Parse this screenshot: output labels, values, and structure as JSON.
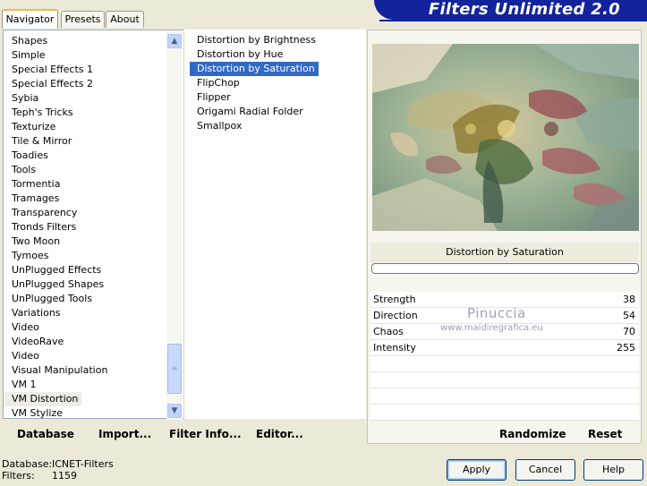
{
  "brand": {
    "title": "Filters Unlimited 2.0"
  },
  "tabs": [
    {
      "label": "Navigator",
      "active": true
    },
    {
      "label": "Presets",
      "active": false
    },
    {
      "label": "About",
      "active": false
    }
  ],
  "categories": {
    "items": [
      "Shapes",
      "Simple",
      "Special Effects 1",
      "Special Effects 2",
      "Sybia",
      "Teph's Tricks",
      "Texturize",
      "Tile & Mirror",
      "Toadies",
      "Tools",
      "Tormentia",
      "Tramages",
      "Transparency",
      "Tronds Filters",
      "Two Moon",
      "Tymoes",
      "UnPlugged Effects",
      "UnPlugged Shapes",
      "UnPlugged Tools",
      "Variations",
      "Video",
      "VideoRave",
      "Video",
      "Visual Manipulation",
      "VM 1",
      "VM Distortion",
      "VM Stylize"
    ],
    "selected": "VM Distortion"
  },
  "filters": {
    "items": [
      "Distortion by Brightness",
      "Distortion by Hue",
      "Distortion by Saturation",
      "FlipChop",
      "Flipper",
      "Origami Radial Folder",
      "Smallpox"
    ],
    "selected": "Distortion by Saturation"
  },
  "links": {
    "database": "Database",
    "import": "Import...",
    "filter_info": "Filter Info...",
    "editor": "Editor..."
  },
  "preview": {
    "filter_name": "Distortion by Saturation",
    "progress": 0
  },
  "params": [
    {
      "name": "Strength",
      "value": "38"
    },
    {
      "name": "Direction",
      "value": "54"
    },
    {
      "name": "Chaos",
      "value": "70"
    },
    {
      "name": "Intensity",
      "value": "255"
    }
  ],
  "watermark": {
    "line1": "Pinuccia",
    "line2": "www.maidiregrafica.eu"
  },
  "right_buttons": {
    "randomize": "Randomize",
    "reset": "Reset"
  },
  "status": {
    "database_label": "Database:",
    "database_value": "ICNET-Filters",
    "filters_label": "Filters:",
    "filters_value": "1159"
  },
  "dialog_buttons": {
    "apply": "Apply",
    "cancel": "Cancel",
    "help": "Help"
  },
  "colors": {
    "brand_bg": "#12239c",
    "selection": "#316ac5",
    "window_bg": "#ece9d8"
  }
}
